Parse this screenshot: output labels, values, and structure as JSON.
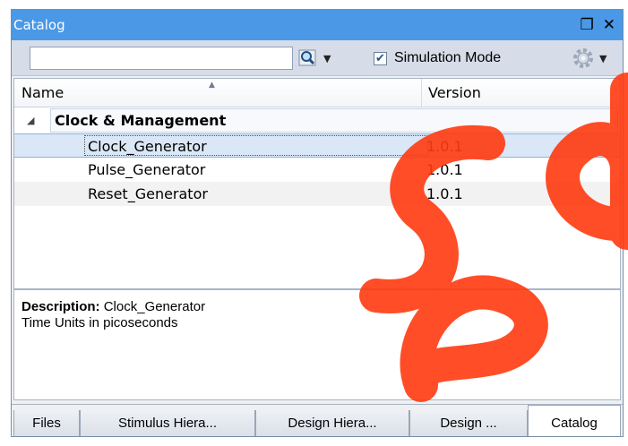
{
  "window": {
    "title": "Catalog",
    "restore_icon": "restore-icon",
    "close_icon": "close-icon"
  },
  "toolbar": {
    "search_value": "",
    "search_placeholder": "",
    "search_icon": "magnifier-icon",
    "simulation_mode_label": "Simulation Mode",
    "simulation_mode_checked": true,
    "settings_icon": "gear-icon"
  },
  "table": {
    "columns": [
      "Name",
      "Version"
    ],
    "group": {
      "label": "Clock & Management",
      "expanded": true
    },
    "rows": [
      {
        "name": "Clock_Generator",
        "version": "1.0.1",
        "selected": true
      },
      {
        "name": "Pulse_Generator",
        "version": "1.0.1",
        "selected": false
      },
      {
        "name": "Reset_Generator",
        "version": "1.0.1",
        "selected": false
      }
    ]
  },
  "description": {
    "label": "Description:",
    "value": "Clock_Generator",
    "detail": "Time Units in picoseconds"
  },
  "tabs": [
    {
      "label": "Files",
      "active": false
    },
    {
      "label": "Stimulus Hiera...",
      "active": false
    },
    {
      "label": "Design Hiera...",
      "active": false
    },
    {
      "label": "Design ...",
      "active": false
    },
    {
      "label": "Catalog",
      "active": true
    }
  ],
  "watermark": "sed"
}
